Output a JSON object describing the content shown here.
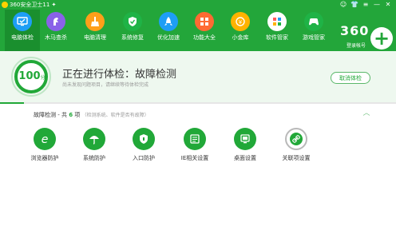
{
  "window": {
    "title": "360安全卫士11 ✦",
    "controls": [
      "☺",
      "👕",
      "≡",
      "—",
      "✕"
    ]
  },
  "toolbar": {
    "tools": [
      {
        "label": "电脑体检",
        "icon": "monitor-check-icon",
        "color": "#1e9ef5",
        "active": true
      },
      {
        "label": "木马查杀",
        "icon": "horse-scan-icon",
        "color": "#8a62e8",
        "active": false
      },
      {
        "label": "电脑清理",
        "icon": "broom-icon",
        "color": "#ff9f1a",
        "active": false
      },
      {
        "label": "系统修复",
        "icon": "shield-icon",
        "color": "#1fb346",
        "active": false
      },
      {
        "label": "优化加速",
        "icon": "rocket-icon",
        "color": "#1e9ef5",
        "active": false
      },
      {
        "label": "功能大全",
        "icon": "apps-icon",
        "color": "#ff6a33",
        "active": false
      },
      {
        "label": "小金库",
        "icon": "coin-icon",
        "color": "#ffb300",
        "active": false
      },
      {
        "label": "软件管家",
        "icon": "software-grid-icon",
        "color": "#ffffff",
        "active": false
      },
      {
        "label": "游戏管家",
        "icon": "gamepad-icon",
        "color": "#1fb346",
        "active": false
      }
    ],
    "brand": "360",
    "login_label": "登录帐号"
  },
  "status": {
    "score": "100",
    "score_unit": "分",
    "title": "正在进行体检：故障检测",
    "subtitle": "尚未发现问题项目，请继续等待体检完成",
    "cancel_label": "取消体检",
    "progress": 0.06
  },
  "section": {
    "title_prefix": "故障检测 - 共",
    "count": "6",
    "title_suffix": "项",
    "note": "（检测系统、软件是否有故障）"
  },
  "items": [
    {
      "label": "浏览器防护",
      "icon": "browser-e-icon"
    },
    {
      "label": "系统防护",
      "icon": "umbrella-icon"
    },
    {
      "label": "入口防护",
      "icon": "shield-lock-icon"
    },
    {
      "label": "IE相关设置",
      "icon": "ie-settings-icon"
    },
    {
      "label": "桌面设置",
      "icon": "desktop-icon"
    },
    {
      "label": "关联项设置",
      "icon": "link-icon"
    }
  ]
}
